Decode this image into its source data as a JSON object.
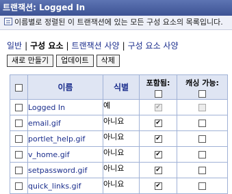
{
  "window": {
    "title": "트랜잭션: Logged In",
    "description": "이름별로 정렬된 이 트랜잭션에 있는 모든 구성 요소의 목록입니다."
  },
  "tabs": [
    {
      "label": "일반",
      "active": false
    },
    {
      "label": "구성 요소",
      "active": true
    },
    {
      "label": "트랜잭션 사양",
      "active": false
    },
    {
      "label": "구성 요소 사양",
      "active": false
    }
  ],
  "separator": "|",
  "buttons": {
    "create": "새로 만들기",
    "update": "업데이트",
    "delete": "삭제"
  },
  "table": {
    "headers": {
      "name": "이름",
      "identifier": "식별",
      "included": "포함됨:",
      "cacheable": "캐싱 가능:"
    },
    "rows": [
      {
        "name": "Logged In",
        "identifier": "예",
        "included": true,
        "included_disabled": true,
        "cacheable": false,
        "cacheable_disabled": true
      },
      {
        "name": "email.gif",
        "identifier": "아니요",
        "included": true,
        "included_disabled": false,
        "cacheable": false,
        "cacheable_disabled": false
      },
      {
        "name": "portlet_help.gif",
        "identifier": "아니요",
        "included": true,
        "included_disabled": false,
        "cacheable": false,
        "cacheable_disabled": false
      },
      {
        "name": "v_home.gif",
        "identifier": "아니요",
        "included": true,
        "included_disabled": false,
        "cacheable": false,
        "cacheable_disabled": false
      },
      {
        "name": "setpassword.gif",
        "identifier": "아니요",
        "included": true,
        "included_disabled": false,
        "cacheable": false,
        "cacheable_disabled": false
      },
      {
        "name": "quick_links.gif",
        "identifier": "아니요",
        "included": true,
        "included_disabled": false,
        "cacheable": false,
        "cacheable_disabled": false
      }
    ]
  }
}
